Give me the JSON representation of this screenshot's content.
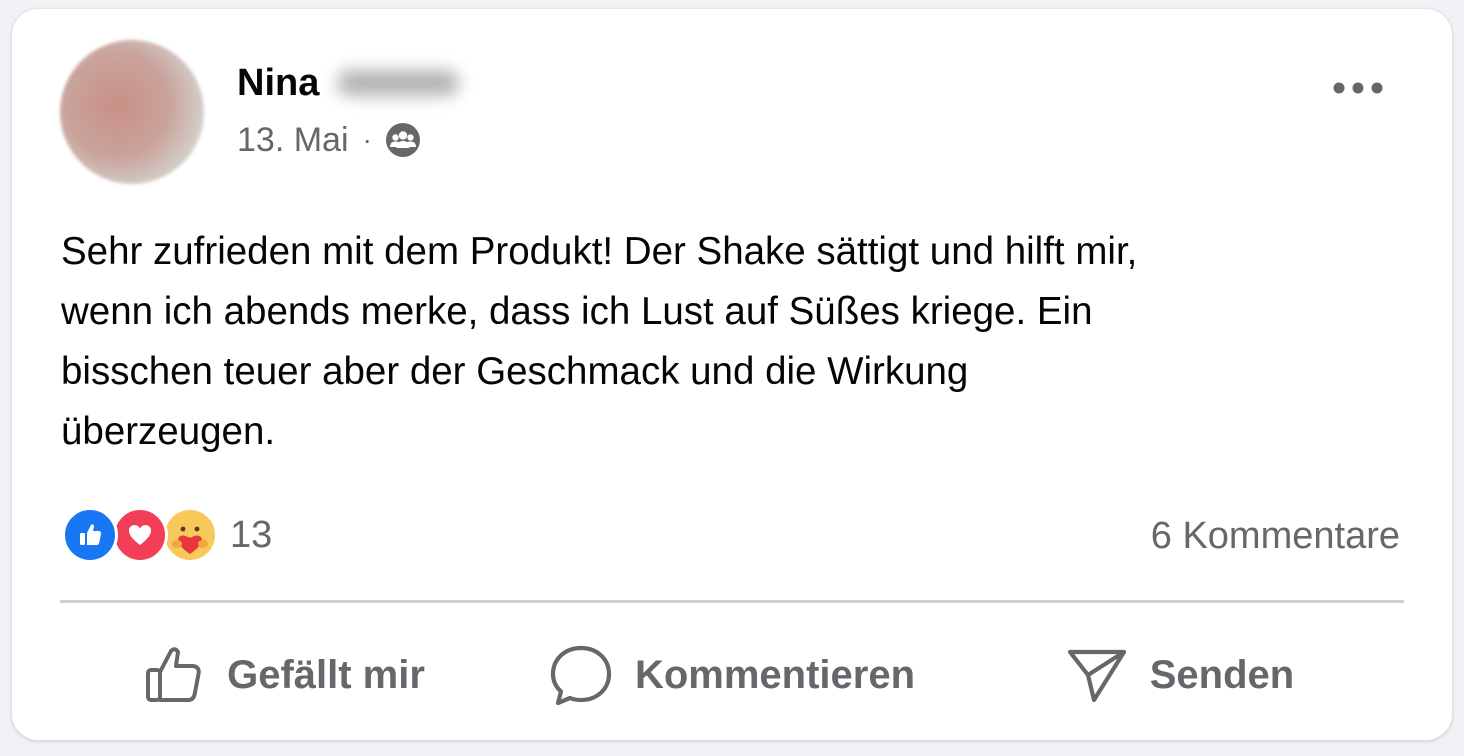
{
  "post": {
    "author_name": "Nina",
    "date": "13. Mai",
    "separator": "·",
    "audience_icon": "group-icon",
    "text": "Sehr zufrieden mit dem Produkt! Der Shake sättigt und hilft mir,\nwenn ich abends merke, dass ich Lust auf Süßes kriege. Ein\nbisschen teuer aber der Geschmack und die Wirkung\nüberzeugen."
  },
  "reactions": {
    "icons": [
      "like-reaction-icon",
      "love-reaction-icon",
      "care-reaction-icon"
    ],
    "count": "13",
    "comments_label": "6 Kommentare"
  },
  "actions": {
    "like_label": "Gefällt mir",
    "comment_label": "Kommentieren",
    "send_label": "Senden"
  },
  "colors": {
    "like_blue": "#1877f2",
    "love_red": "#f33e58",
    "care_yellow": "#f7c85a",
    "secondary_text": "#65676b",
    "primary_text": "#050505"
  }
}
